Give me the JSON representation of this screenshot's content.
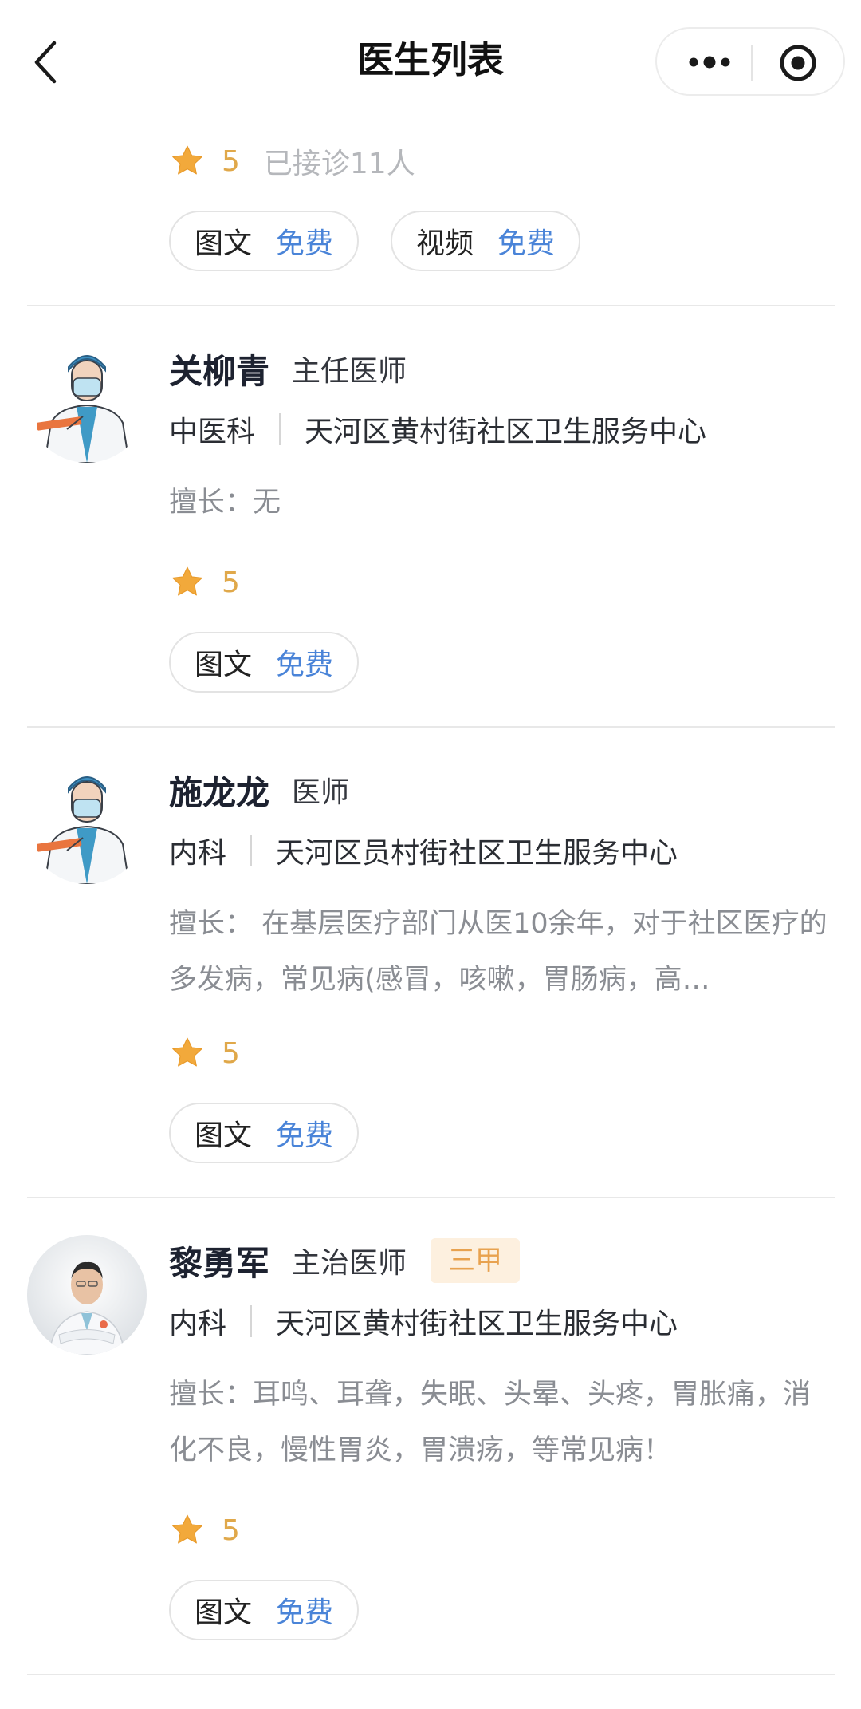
{
  "nav": {
    "title": "医生列表",
    "back_icon": "chevron-left-icon",
    "more_icon": "more-dots-icon",
    "close_icon": "target-close-icon"
  },
  "colors": {
    "price": "#4a84d8",
    "rating": "#e0a84a",
    "badge_bg": "#fdf0df",
    "badge_text": "#e8a24f"
  },
  "cards": [
    {
      "rating": "5",
      "consult_count": "已接诊11人",
      "services": [
        {
          "name": "图文",
          "price": "免费"
        },
        {
          "name": "视频",
          "price": "免费"
        }
      ]
    },
    {
      "name": "关柳青",
      "title": "主任医师",
      "department": "中医科",
      "hospital": "天河区黄村街社区卫生服务中心",
      "skill": "擅长：无",
      "rating": "5",
      "services": [
        {
          "name": "图文",
          "price": "免费"
        }
      ]
    },
    {
      "name": "施龙龙",
      "title": "医师",
      "department": "内科",
      "hospital": "天河区员村街社区卫生服务中心",
      "skill": "擅长： 在基层医疗部门从医10余年，对于社区医疗的多发病，常见病(感冒，咳嗽，胃肠病，高…",
      "rating": "5",
      "services": [
        {
          "name": "图文",
          "price": "免费"
        }
      ]
    },
    {
      "name": "黎勇军",
      "title": "主治医师",
      "badge": "三甲",
      "department": "内科",
      "hospital": "天河区黄村街社区卫生服务中心",
      "skill": "擅长：耳鸣、耳聋，失眠、头晕、头疼，胃胀痛，消化不良，慢性胃炎，胃溃疡，等常见病！",
      "rating": "5",
      "services": [
        {
          "name": "图文",
          "price": "免费"
        }
      ]
    }
  ]
}
